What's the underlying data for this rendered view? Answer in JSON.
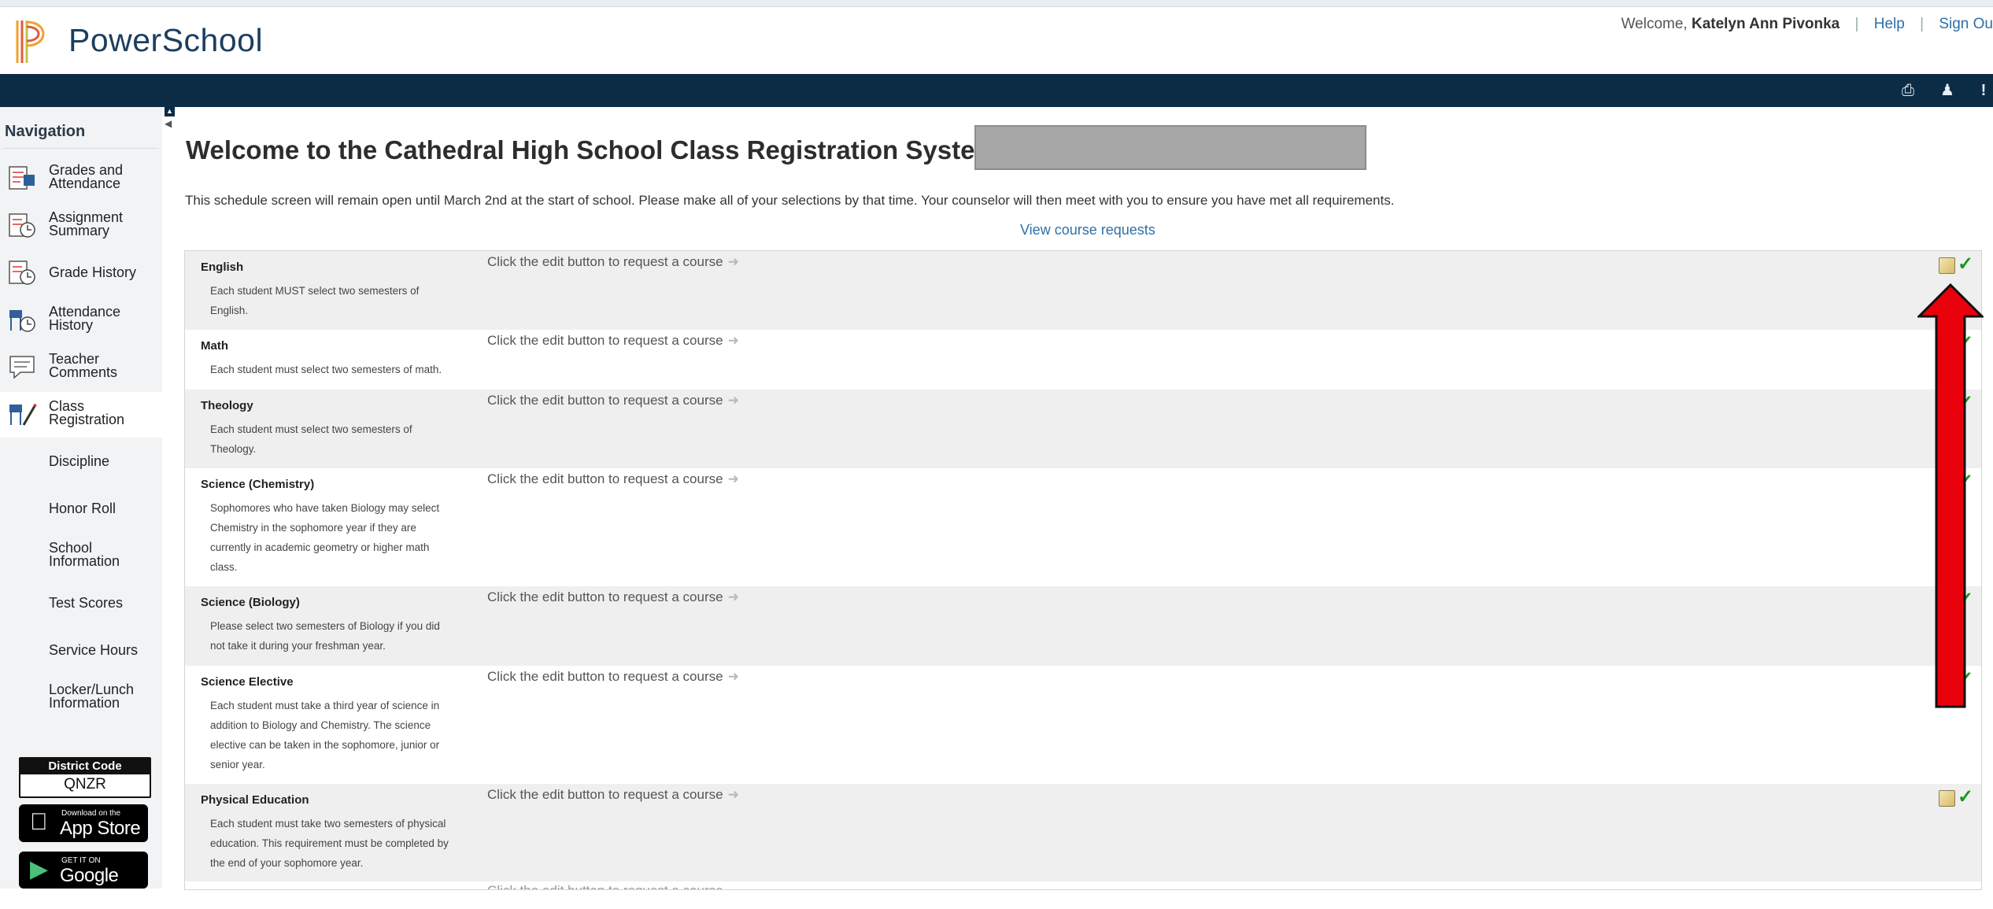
{
  "app": {
    "name": "PowerSchool"
  },
  "header": {
    "welcome_prefix": "Welcome,",
    "user_name": "Katelyn Ann Pivonka",
    "help_link": "Help",
    "signout_link": "Sign Ou"
  },
  "toolbar": {
    "icons": [
      "print-icon",
      "person-icon",
      "alert-icon"
    ]
  },
  "nav": {
    "title": "Navigation",
    "items": [
      {
        "line1": "Grades and",
        "line2": "Attendance",
        "icon": "grades-icon"
      },
      {
        "line1": "Assignment",
        "line2": "Summary",
        "icon": "assignment-icon"
      },
      {
        "line1": "Grade History",
        "line2": "",
        "icon": "grade-history-icon"
      },
      {
        "line1": "Attendance",
        "line2": "History",
        "icon": "attendance-history-icon"
      },
      {
        "line1": "Teacher",
        "line2": "Comments",
        "icon": "comments-icon"
      },
      {
        "line1": "Class",
        "line2": "Registration",
        "icon": "registration-icon"
      },
      {
        "line1": "Discipline",
        "line2": ""
      },
      {
        "line1": "Honor Roll",
        "line2": ""
      },
      {
        "line1": "School",
        "line2": "Information"
      },
      {
        "line1": "Test Scores",
        "line2": ""
      },
      {
        "line1": "Service Hours",
        "line2": ""
      },
      {
        "line1": "Locker/Lunch",
        "line2": "Information"
      }
    ],
    "active_item": "Class Registration",
    "district_code_label": "District Code",
    "district_code_value": "QNZR",
    "appstore_small": "Download on the",
    "appstore_big": "App Store",
    "googleplay_small": "GET IT ON",
    "googleplay_big": "Google play"
  },
  "main": {
    "title": "Welcome to the Cathedral High School Class Registration System for",
    "intro": "This schedule screen will remain open until March 2nd at the start of school. Please make all of your selections by that time. Your counselor will then meet with you to ensure you have met all requirements.",
    "view_requests_link": "View course requests",
    "prompt": "Click the edit button to request a course",
    "rows": [
      {
        "title": "English",
        "desc": [
          "Each student MUST select two semesters of",
          "English."
        ]
      },
      {
        "title": "Math",
        "desc": [
          "Each student must select two semesters of math."
        ]
      },
      {
        "title": "Theology",
        "desc": [
          "Each student must select two semesters of",
          "Theology."
        ]
      },
      {
        "title": "Science (Chemistry)",
        "desc": [
          "Sophomores who have taken Biology may select",
          "Chemistry in the sophomore year if they are",
          "currently in academic geometry or higher math",
          "class."
        ]
      },
      {
        "title": "Science (Biology)",
        "desc": [
          "Please select two semesters of Biology if you did",
          "not take it during your freshman year."
        ]
      },
      {
        "title": "Science Elective",
        "desc": [
          "Each student must take a third year of science in",
          "addition to Biology and Chemistry. The science",
          "elective can be taken in the sophomore, junior or",
          "senior year."
        ]
      },
      {
        "title": "Physical Education",
        "desc": [
          "Each student must take two semesters of physical",
          "education. This requirement must be completed by",
          "the end of your sophomore year."
        ]
      }
    ],
    "partial_row_prompt": "Click the edit button to request a course"
  },
  "colors": {
    "topbar": "#0c2b45",
    "link": "#2f6fa7",
    "annotation_arrow": "#e8000b"
  }
}
